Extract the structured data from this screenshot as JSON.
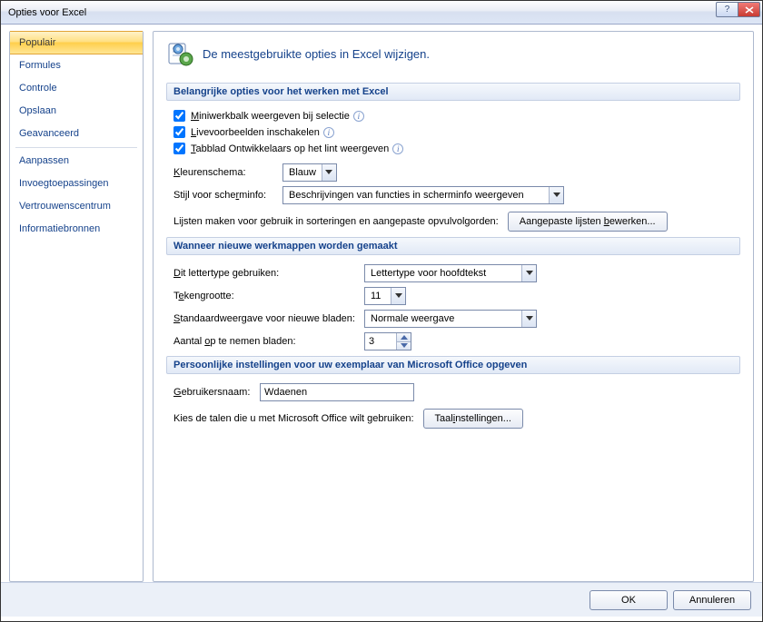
{
  "window": {
    "title": "Opties voor Excel"
  },
  "sidebar": {
    "items": [
      "Populair",
      "Formules",
      "Controle",
      "Opslaan",
      "Geavanceerd",
      "Aanpassen",
      "Invoegtoepassingen",
      "Vertrouwenscentrum",
      "Informatiebronnen"
    ]
  },
  "header": {
    "subtitle": "De meestgebruikte opties in Excel wijzigen."
  },
  "section1": {
    "title": "Belangrijke opties voor het werken met Excel",
    "cb1": "Miniwerkbalk weergeven bij selectie",
    "cb2": "Livevoorbeelden inschakelen",
    "cb3": "Tabblad Ontwikkelaars op het lint weergeven",
    "colorLabel": "Kleurenschema:",
    "colorValue": "Blauw",
    "tipLabel": "Stijl voor scherminfo:",
    "tipValue": "Beschrijvingen van functies in scherminfo weergeven",
    "listsLabel": "Lijsten maken voor gebruik in sorteringen en aangepaste opvulvolgorden:",
    "listsBtn": "Aangepaste lijsten bewerken..."
  },
  "section2": {
    "title": "Wanneer nieuwe werkmappen worden gemaakt",
    "fontLabel": "Dit lettertype gebruiken:",
    "fontValue": "Lettertype voor hoofdtekst",
    "sizeLabel": "Tekengrootte:",
    "sizeValue": "11",
    "viewLabel": "Standaardweergave voor nieuwe bladen:",
    "viewValue": "Normale weergave",
    "sheetsLabel": "Aantal op te nemen bladen:",
    "sheetsValue": "3"
  },
  "section3": {
    "title": "Persoonlijke instellingen voor uw exemplaar van Microsoft Office opgeven",
    "userLabel": "Gebruikersnaam:",
    "userValue": "Wdaenen",
    "langLabel": "Kies de talen die u met Microsoft Office wilt gebruiken:",
    "langBtn": "Taalinstellingen..."
  },
  "footer": {
    "ok": "OK",
    "cancel": "Annuleren"
  }
}
